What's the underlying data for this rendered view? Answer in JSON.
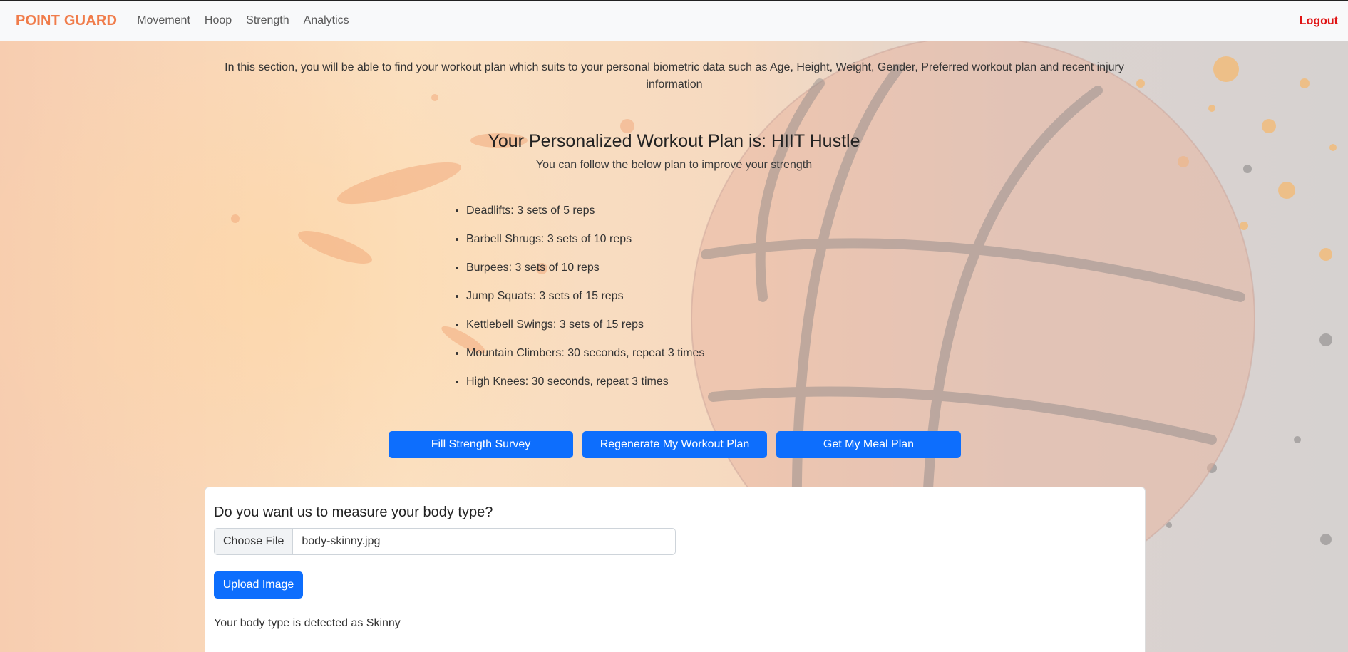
{
  "navbar": {
    "brand": "POINT GUARD",
    "links": [
      "Movement",
      "Hoop",
      "Strength",
      "Analytics"
    ],
    "logout": "Logout"
  },
  "intro": "In this section, you will be able to find your workout plan which suits to your personal biometric data such as Age, Height, Weight, Gender, Preferred workout plan and recent injury information",
  "plan": {
    "title": "Your Personalized Workout Plan is: HIIT Hustle",
    "subtitle": "You can follow the below plan to improve your strength",
    "exercises": [
      "Deadlifts: 3 sets of 5 reps",
      "Barbell Shrugs: 3 sets of 10 reps",
      "Burpees: 3 sets of 10 reps",
      "Jump Squats: 3 sets of 15 reps",
      "Kettlebell Swings: 3 sets of 15 reps",
      "Mountain Climbers: 30 seconds, repeat 3 times",
      "High Knees: 30 seconds, repeat 3 times"
    ]
  },
  "actions": {
    "survey": "Fill Strength Survey",
    "regenerate": "Regenerate My Workout Plan",
    "meal": "Get My Meal Plan"
  },
  "body_type": {
    "title": "Do you want us to measure your body type?",
    "choose_file": "Choose File",
    "file_name": "body-skinny.jpg",
    "upload": "Upload Image",
    "result": "Your body type is detected as Skinny"
  },
  "colors": {
    "brand": "#f07c4a",
    "primary": "#0d6efd",
    "logout": "#e01414"
  }
}
